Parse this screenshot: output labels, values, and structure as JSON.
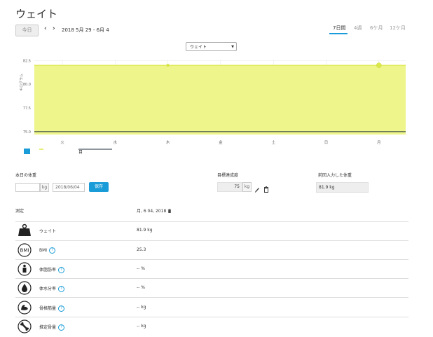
{
  "header": {
    "title": "ウェイト"
  },
  "toolbar": {
    "today_label": "今日",
    "prev_icon": "chevron-left-icon",
    "next_icon": "chevron-right-icon",
    "date_range": "2018 5月 29 - 6月 4",
    "range_tabs": [
      {
        "label": "7日間",
        "active": true
      },
      {
        "label": "4週",
        "active": false
      },
      {
        "label": "6ケ月",
        "active": false
      },
      {
        "label": "12ケ月",
        "active": false
      }
    ]
  },
  "metric_select": {
    "value": "ウェイト"
  },
  "chart_data": {
    "type": "area",
    "ylabel": "キログラム",
    "x": [
      "火",
      "水",
      "木",
      "金",
      "土",
      "日",
      "月"
    ],
    "y_ticks": [
      "82.5",
      "80.0",
      "77.5",
      "75.0"
    ],
    "ylim": [
      74.7,
      82.6
    ],
    "series": [
      {
        "values": [
          82.0,
          82.0,
          82.0,
          82.0,
          82.0,
          82.0,
          82.0
        ],
        "color": "#eef58a"
      }
    ],
    "points": [
      {
        "x": "木",
        "y": 82.0,
        "size": "small"
      },
      {
        "x": "月",
        "y": 82.0,
        "size": "large"
      }
    ],
    "goal_line": 75.0,
    "goal_color": "#1a2a3a",
    "grid": true,
    "legend": [
      {
        "label": "",
        "color": "#1a9cd8"
      },
      {
        "label": "",
        "color": "#dce84a"
      },
      {
        "label": "目",
        "color": "#1a2a3a"
      }
    ]
  },
  "entry": {
    "today_weight_label": "本日の体重",
    "weight_value": "",
    "unit": "kg",
    "date_value": "2018/06/04",
    "save_label": "保存",
    "goal_label": "目標達成度",
    "goal_value": "75",
    "goal_unit": "kg",
    "last_label": "前回入力した体重",
    "last_value": "81.9 kg"
  },
  "measurements": {
    "header_label": "測定",
    "header_date": "月, 6 04, 2018",
    "rows": [
      {
        "label": "ウェイト",
        "value": "81.9  kg",
        "help": false,
        "icon": "weight-icon"
      },
      {
        "label": "BMI",
        "value": "25.3",
        "help": true,
        "icon": "bmi-icon"
      },
      {
        "label": "体脂肪率",
        "value": "--  %",
        "help": true,
        "icon": "body-fat-icon"
      },
      {
        "label": "体水分率",
        "value": "--  %",
        "help": true,
        "icon": "water-icon"
      },
      {
        "label": "骨格筋量",
        "value": "--  kg",
        "help": true,
        "icon": "muscle-icon"
      },
      {
        "label": "推定骨量",
        "value": "--  kg",
        "help": true,
        "icon": "bone-icon"
      }
    ]
  }
}
